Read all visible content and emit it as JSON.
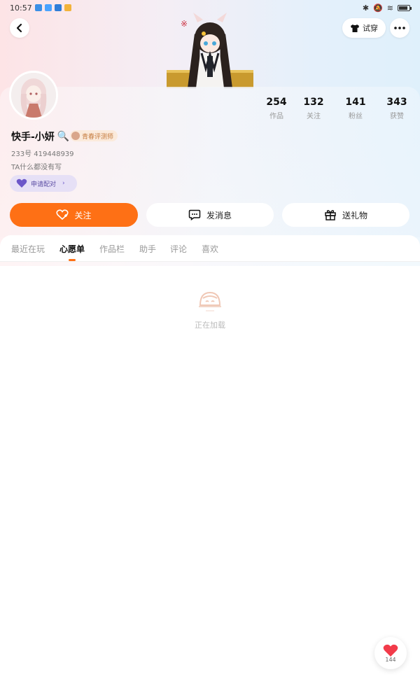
{
  "status_bar": {
    "time": "10:57"
  },
  "header": {
    "tryon_label": "试穿"
  },
  "profile": {
    "stats": [
      {
        "value": "254",
        "label": "作品"
      },
      {
        "value": "132",
        "label": "关注"
      },
      {
        "value": "141",
        "label": "粉丝"
      },
      {
        "value": "343",
        "label": "获赞"
      }
    ],
    "username": "快手-小妍",
    "username_emoji": "🔍",
    "badge": "青春评测师",
    "user_id": "233号 419448939",
    "bio": "TA什么都没有写",
    "match_chip": "申请配对"
  },
  "actions": {
    "follow": "关注",
    "message": "发消息",
    "gift": "送礼物"
  },
  "tabs": [
    "最近在玩",
    "心愿单",
    "作品栏",
    "助手",
    "评论",
    "喜欢"
  ],
  "active_tab": "心愿单",
  "loading_text": "正在加载",
  "like_fab": {
    "count": "144"
  },
  "colors": {
    "accent": "#fe7015",
    "match": "#5a4ba3"
  }
}
